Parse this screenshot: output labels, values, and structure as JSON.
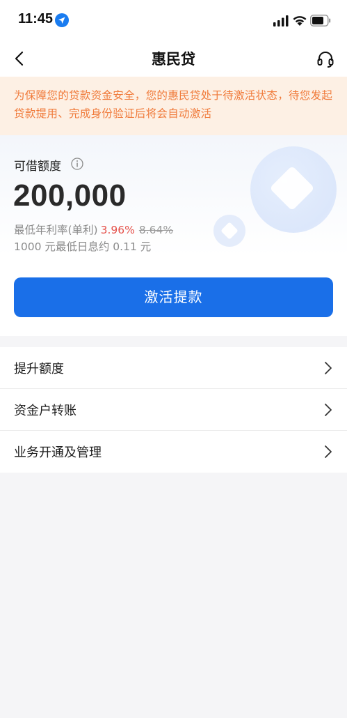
{
  "status_bar": {
    "time": "11:45",
    "icons": [
      "location-arrow-icon",
      "signal-icon",
      "wifi-icon",
      "battery-icon"
    ]
  },
  "nav": {
    "title": "惠民贷",
    "back_icon": "chevron-left-icon",
    "service_icon": "headset-icon"
  },
  "notice": {
    "text": "为保障您的贷款资金安全，您的惠民贷处于待激活状态，待您发起贷款提用、完成身份验证后将会自动激活"
  },
  "quota": {
    "label": "可借额度",
    "amount": "200,000",
    "rate_prefix": "最低年利率(单利)",
    "rate_current": "3.96%",
    "rate_original": "8.64%",
    "interest_text": "1000 元最低日息约 0.11 元",
    "button_label": "激活提款"
  },
  "menu": {
    "items": [
      {
        "label": "提升额度"
      },
      {
        "label": "资金户转账"
      },
      {
        "label": "业务开通及管理"
      }
    ]
  },
  "colors": {
    "primary": "#1a6fe8",
    "notice_text": "#f07a3a",
    "notice_bg": "#fdf0e4",
    "rate_highlight": "#e5514a"
  }
}
